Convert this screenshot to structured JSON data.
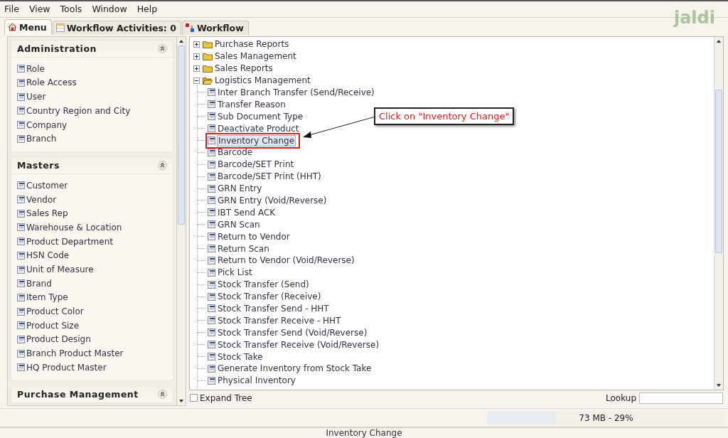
{
  "menu_bar": [
    "File",
    "View",
    "Tools",
    "Window",
    "Help"
  ],
  "logo": "jaldi",
  "tabs": [
    {
      "label": "Menu",
      "selected": true
    },
    {
      "label": "Workflow Activities: 0",
      "selected": false
    },
    {
      "label": "Workflow",
      "selected": false
    }
  ],
  "sidebar": {
    "sections": [
      {
        "title": "Administration",
        "expanded": true,
        "items": [
          "Role",
          "Role Access",
          "User",
          "Country Region and City",
          "Company",
          "Branch"
        ]
      },
      {
        "title": "Masters",
        "expanded": true,
        "items": [
          "Customer",
          "Vendor",
          "Sales Rep",
          "Warehouse & Location",
          "Product Department",
          "HSN Code",
          "Unit of Measure",
          "Brand",
          "Item Type",
          "Product Color",
          "Product Size",
          "Product Design",
          "Branch Product Master",
          "HQ Product Master"
        ]
      },
      {
        "title": "Purchase Management",
        "expanded": true
      }
    ]
  },
  "tree": [
    {
      "label": "Purchase Reports",
      "kind": "folder",
      "expanded": false
    },
    {
      "label": "Sales Management",
      "kind": "folder",
      "expanded": false
    },
    {
      "label": "Sales Reports",
      "kind": "folder",
      "expanded": false
    },
    {
      "label": "Logistics Management",
      "kind": "folder",
      "expanded": true,
      "children": [
        {
          "label": "Inter Branch Transfer (Send/Receive)",
          "kind": "leaf",
          "selected": false,
          "highlighted": false
        },
        {
          "label": "Transfer Reason",
          "kind": "leaf",
          "selected": false,
          "highlighted": false
        },
        {
          "label": "Sub Document Type",
          "kind": "leaf",
          "selected": false,
          "highlighted": false
        },
        {
          "label": "Deactivate Product",
          "kind": "leaf",
          "selected": false,
          "highlighted": false
        },
        {
          "label": "Inventory Change",
          "kind": "leaf",
          "selected": true,
          "highlighted": true
        },
        {
          "label": "Barcode",
          "kind": "leaf",
          "selected": false,
          "highlighted": false
        },
        {
          "label": "Barcode/SET Print",
          "kind": "leaf",
          "selected": false,
          "highlighted": false
        },
        {
          "label": "Barcode/SET Print (HHT)",
          "kind": "leaf",
          "selected": false,
          "highlighted": false
        },
        {
          "label": "GRN Entry",
          "kind": "leaf",
          "selected": false,
          "highlighted": false
        },
        {
          "label": "GRN Entry (Void/Reverse)",
          "kind": "leaf",
          "selected": false,
          "highlighted": false
        },
        {
          "label": "IBT Send ACK",
          "kind": "leaf",
          "selected": false,
          "highlighted": false
        },
        {
          "label": "GRN Scan",
          "kind": "leaf",
          "selected": false,
          "highlighted": false
        },
        {
          "label": "Return to Vendor",
          "kind": "leaf",
          "selected": false,
          "highlighted": false
        },
        {
          "label": "Return Scan",
          "kind": "leaf",
          "selected": false,
          "highlighted": false
        },
        {
          "label": "Return to Vendor (Void/Reverse)",
          "kind": "leaf",
          "selected": false,
          "highlighted": false
        },
        {
          "label": "Pick List",
          "kind": "leaf",
          "selected": false,
          "highlighted": false
        },
        {
          "label": "Stock Transfer (Send)",
          "kind": "leaf",
          "selected": false,
          "highlighted": false
        },
        {
          "label": "Stock Transfer (Receive)",
          "kind": "leaf",
          "selected": false,
          "highlighted": false
        },
        {
          "label": "Stock Transfer Send - HHT",
          "kind": "leaf",
          "selected": false,
          "highlighted": false
        },
        {
          "label": "Stock Transfer Receive - HHT",
          "kind": "leaf",
          "selected": false,
          "highlighted": false
        },
        {
          "label": "Stock Transfer Send (Void/Reverse)",
          "kind": "leaf",
          "selected": false,
          "highlighted": false
        },
        {
          "label": "Stock Transfer Receive (Void/Reverse)",
          "kind": "leaf",
          "selected": false,
          "highlighted": false
        },
        {
          "label": "Stock Take",
          "kind": "leaf",
          "selected": false,
          "highlighted": false
        },
        {
          "label": "Generate Inventory from Stock Take",
          "kind": "leaf",
          "selected": false,
          "highlighted": false
        },
        {
          "label": "Physical Inventory",
          "kind": "leaf",
          "selected": false,
          "highlighted": false
        }
      ]
    }
  ],
  "callout": {
    "text": "Click on \"Inventory Change\""
  },
  "expand_tree": {
    "label": "Expand Tree",
    "checked": false
  },
  "lookup": {
    "label": "Lookup"
  },
  "memory": {
    "level": 0.29,
    "reading": "73 MB - 29%"
  },
  "status_bar": "Inventory Change"
}
